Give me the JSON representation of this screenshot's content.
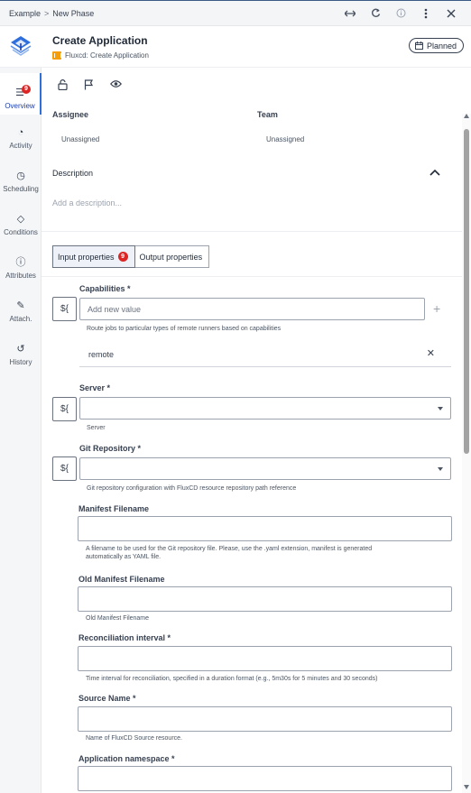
{
  "breadcrumb": {
    "root": "Example",
    "separator": ">",
    "current": "New Phase"
  },
  "header": {
    "title": "Create Application",
    "subtitle": "Fluxcd: Create Application",
    "status": "Planned"
  },
  "sidebar": {
    "items": [
      {
        "label": "Overview",
        "badge": "9"
      },
      {
        "label": "Activity"
      },
      {
        "label": "Scheduling"
      },
      {
        "label": "Conditions"
      },
      {
        "label": "Attributes"
      },
      {
        "label": "Attach."
      },
      {
        "label": "History"
      }
    ]
  },
  "overview": {
    "assignee_label": "Assignee",
    "assignee_value": "Unassigned",
    "team_label": "Team",
    "team_value": "Unassigned",
    "description_label": "Description",
    "description_placeholder": "Add a description..."
  },
  "tabs": {
    "input_label": "Input properties",
    "input_badge": "9",
    "output_label": "Output properties"
  },
  "fields": {
    "expr_symbol": "${",
    "capabilities_label": "Capabilities *",
    "capabilities_placeholder": "Add new value",
    "capabilities_hint": "Route jobs to particular types of remote runners based on capabilities",
    "capabilities_value": "remote",
    "server_label": "Server *",
    "server_hint": "Server",
    "git_label": "Git Repository *",
    "git_hint": "Git repository configuration with FluxCD resource repository path reference",
    "manifest_label": "Manifest Filename",
    "manifest_hint_1": "A filename to be used for the Git repository file. Please, use the .yaml extension, manifest is generated",
    "manifest_hint_2": "automatically as YAML file.",
    "old_manifest_label": "Old Manifest Filename",
    "old_manifest_hint": "Old Manifest Filename",
    "reconciliation_label": "Reconciliation interval *",
    "reconciliation_hint": "Time interval for reconciliation, specified in a duration format (e.g., 5m30s for 5 minutes and 30 seconds)",
    "source_label": "Source Name *",
    "source_hint": "Name of FluxCD Source resource.",
    "namespace_label": "Application namespace *"
  },
  "colors": {
    "accent": "#2f6fdd",
    "badge": "#dc2626",
    "tab_active_bg": "#eef2f8",
    "warning": "#f59e0b"
  }
}
